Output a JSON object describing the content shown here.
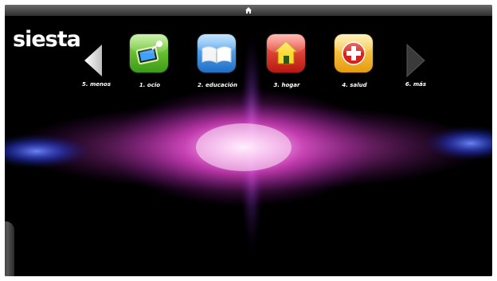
{
  "topbar": {
    "home_icon": "home-icon"
  },
  "logo": {
    "text": "siesta"
  },
  "navigation": {
    "previous": {
      "label": "5. menos",
      "icon": "arrow-left-icon"
    },
    "next": {
      "label": "6. más",
      "icon": "arrow-right-icon"
    }
  },
  "menu": {
    "items": [
      {
        "label": "1. ocio",
        "icon": "tv-icon",
        "color": "#5fbf2a"
      },
      {
        "label": "2. educación",
        "icon": "book-icon",
        "color": "#2f8fe0"
      },
      {
        "label": "3. hogar",
        "icon": "house-icon",
        "color": "#d8342a"
      },
      {
        "label": "4. salud",
        "icon": "health-cross-icon",
        "color": "#f2b51c"
      }
    ]
  },
  "colors": {
    "background": "#000000",
    "glow_pink": "#e040c8",
    "glow_blue": "#3a5cff"
  }
}
